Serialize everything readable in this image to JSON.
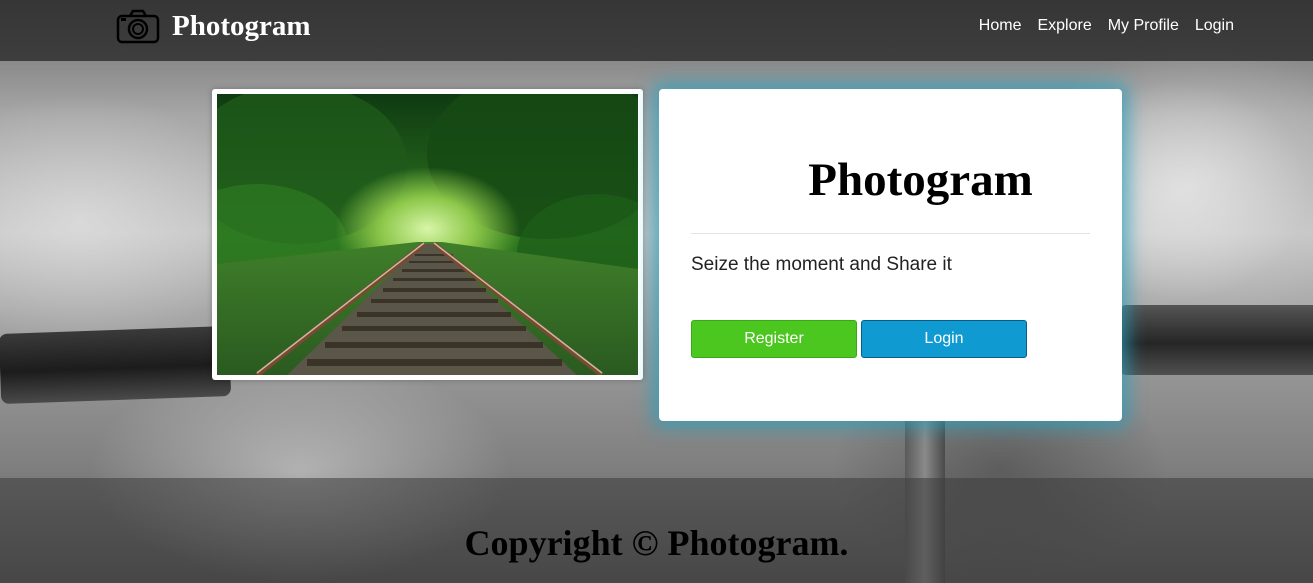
{
  "navbar": {
    "brand": "Photogram",
    "links": [
      "Home",
      "Explore",
      "My Profile",
      "Login"
    ]
  },
  "hero": {
    "title": "Photogram",
    "tagline": "Seize the moment and Share it",
    "register_label": "Register",
    "login_label": "Login"
  },
  "footer": {
    "text": "Copyright © Photogram."
  },
  "icons": {
    "brand_logo": "camera-icon"
  },
  "colors": {
    "register": "#4cc71f",
    "login": "#0f9bd1",
    "hero_glow": "#28a0be"
  }
}
